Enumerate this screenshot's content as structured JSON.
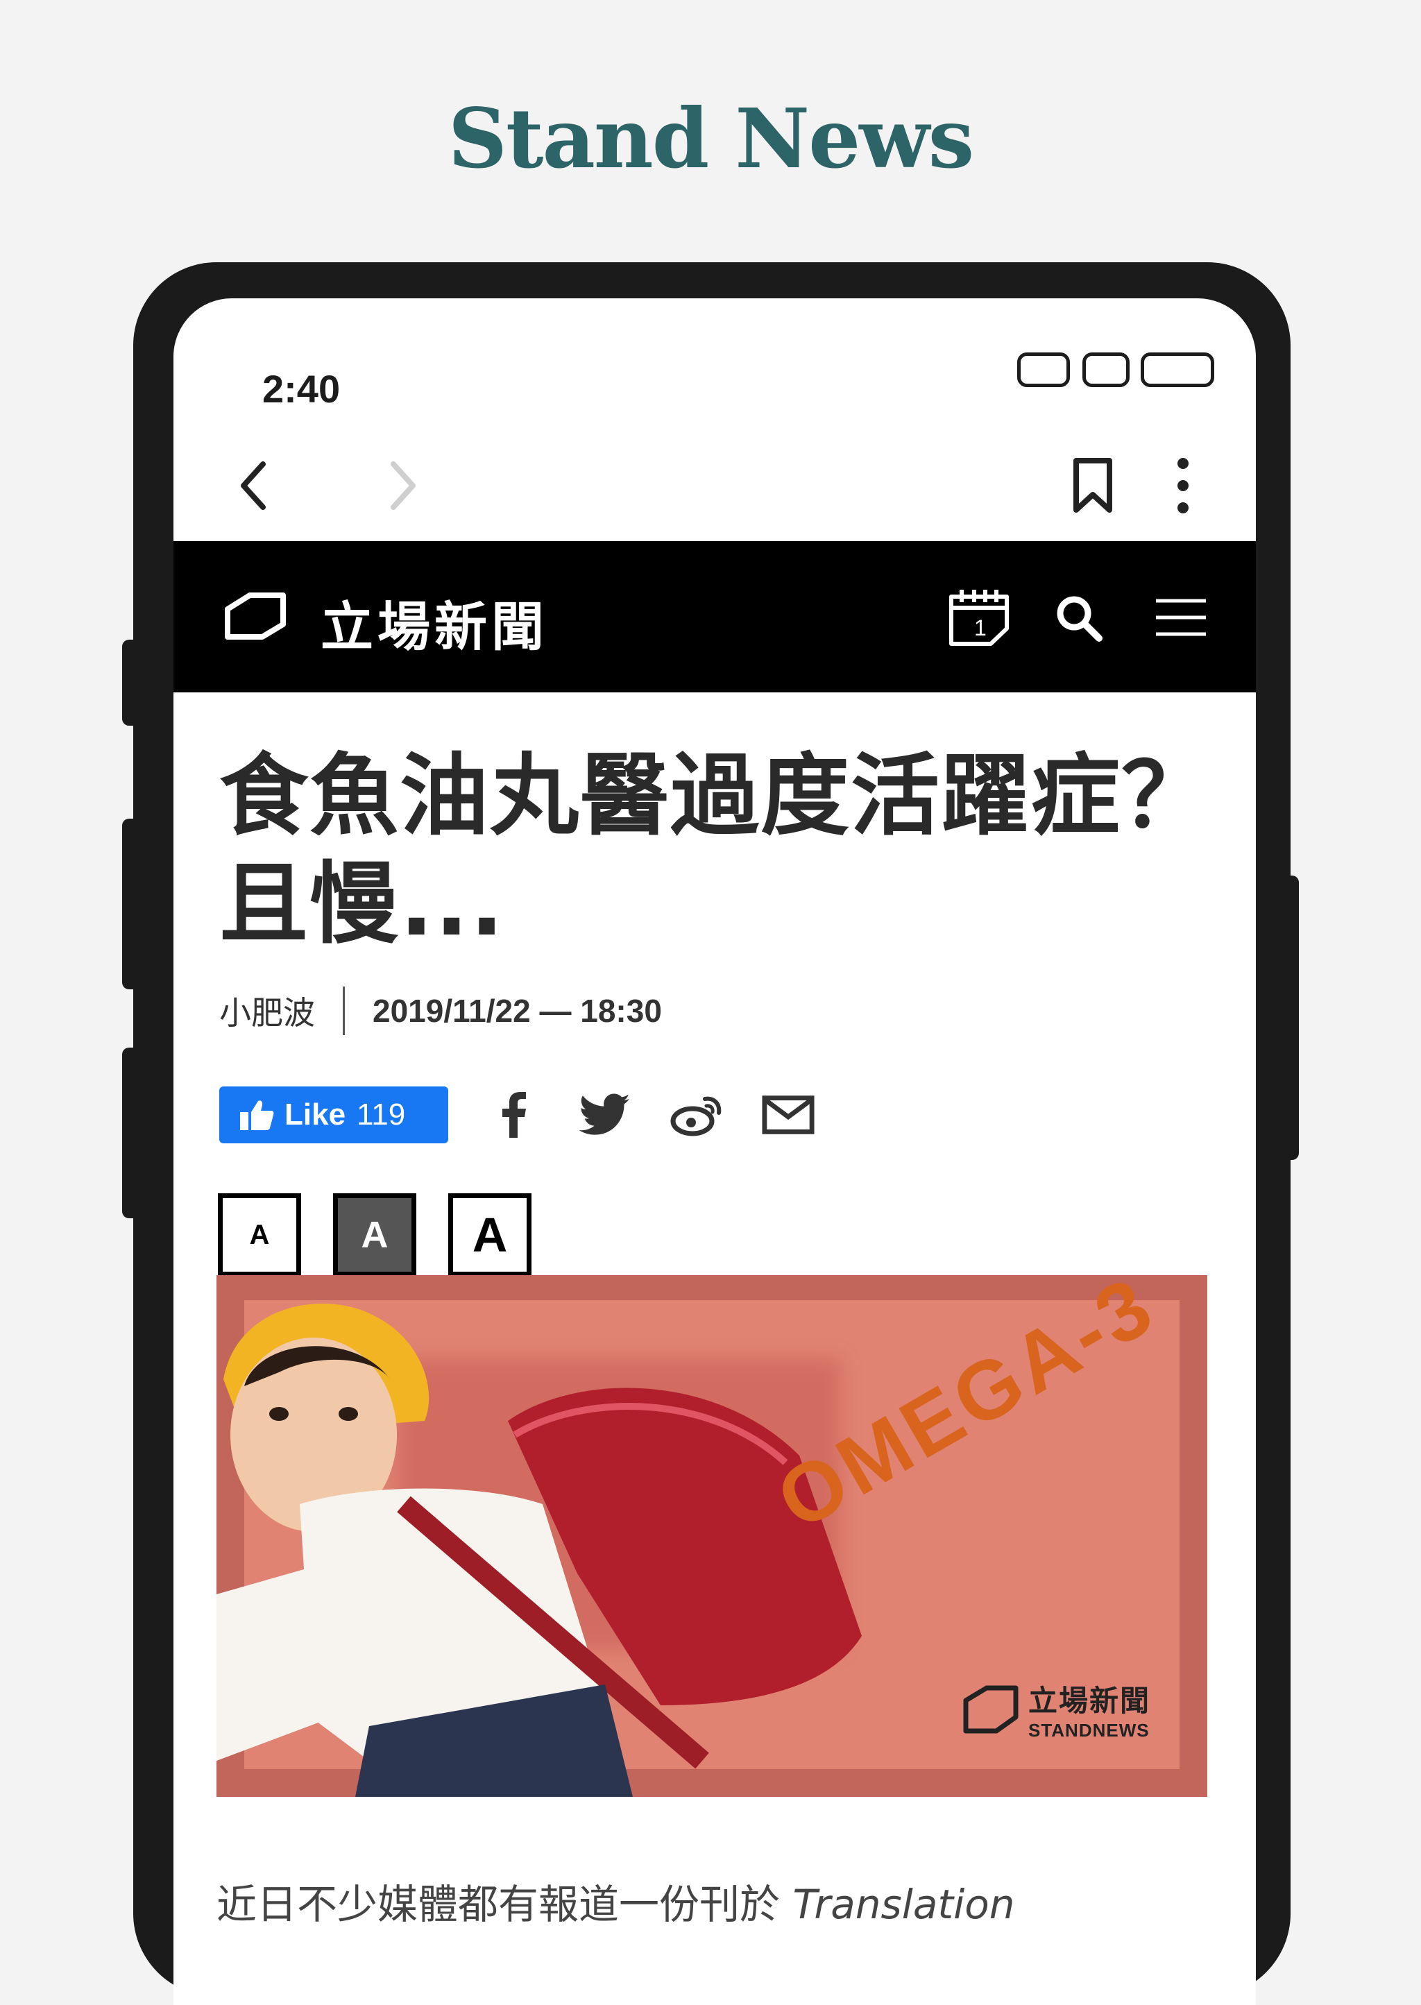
{
  "app_title": "Stand News",
  "status_bar": {
    "time": "2:40"
  },
  "site": {
    "name": "立場新聞",
    "calendar_day": "1"
  },
  "article": {
    "headline": "食魚油丸醫過度活躍症？且慢...",
    "author": "小肥波",
    "datetime": "2019/11/22 — 18:30",
    "like_label": "Like",
    "like_count": "119",
    "font_sizes": [
      "A",
      "A",
      "A"
    ],
    "hero_caption_text": "OMEGA-3",
    "hero_logo_zh": "立場新聞",
    "hero_logo_en": "STANDNEWS",
    "body_start": "近日不少媒體都有報道一份刊於",
    "body_italic": "Translation"
  },
  "colors": {
    "title": "#2d6468",
    "like": "#1877f2",
    "hero_bg": "#e08373"
  }
}
